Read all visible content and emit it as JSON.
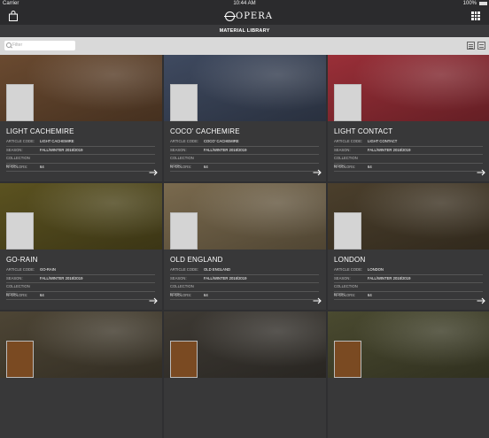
{
  "status": {
    "carrier": "Carrier",
    "time": "10:44 AM",
    "battery": "100%"
  },
  "header": {
    "logo_text": "OPERA"
  },
  "page": {
    "title": "MATERIAL LIBRARY"
  },
  "search": {
    "placeholder": "Filter"
  },
  "labels": {
    "article": "ARTICLE CODE:",
    "season": "SEASON:",
    "book": "COLLECTION BOOK:",
    "colors": "N. COLORS:"
  },
  "cards": [
    {
      "name": "LIGHT CACHEMIRE",
      "article": "LIGHT CACHEMIRE",
      "season": "FALL/WINTER 2018/2019",
      "book": "",
      "colors": "64",
      "color": "#6a4a30"
    },
    {
      "name": "COCO' CACHEMIRE",
      "article": "COCO' CACHEMIRE",
      "season": "FALL/WINTER 2018/2019",
      "book": "",
      "colors": "64",
      "color": "#3f4a60"
    },
    {
      "name": "LIGHT CONTACT",
      "article": "LIGHT CONTACT",
      "season": "FALL/WINTER 2018/2019",
      "book": "",
      "colors": "64",
      "color": "#9a2f38"
    },
    {
      "name": "GO-RAIN",
      "article": "GO-RAIN",
      "season": "FALL/WINTER 2018/2019",
      "book": "",
      "colors": "64",
      "color": "#5b5220"
    },
    {
      "name": "OLD ENGLAND",
      "article": "OLD ENGLAND",
      "season": "FALL/WINTER 2018/2019",
      "book": "",
      "colors": "64",
      "color": "#7a6a4e"
    },
    {
      "name": "LONDON",
      "article": "LONDON",
      "season": "FALL/WINTER 2018/2019",
      "book": "",
      "colors": "64",
      "color": "#4b3f2c"
    },
    {
      "name": "",
      "article": "",
      "season": "",
      "book": "",
      "colors": "",
      "color": "#4d4535"
    },
    {
      "name": "",
      "article": "",
      "season": "",
      "book": "",
      "colors": "",
      "color": "#3e3a34"
    },
    {
      "name": "",
      "article": "",
      "season": "",
      "book": "",
      "colors": "",
      "color": "#4a4a30"
    }
  ]
}
